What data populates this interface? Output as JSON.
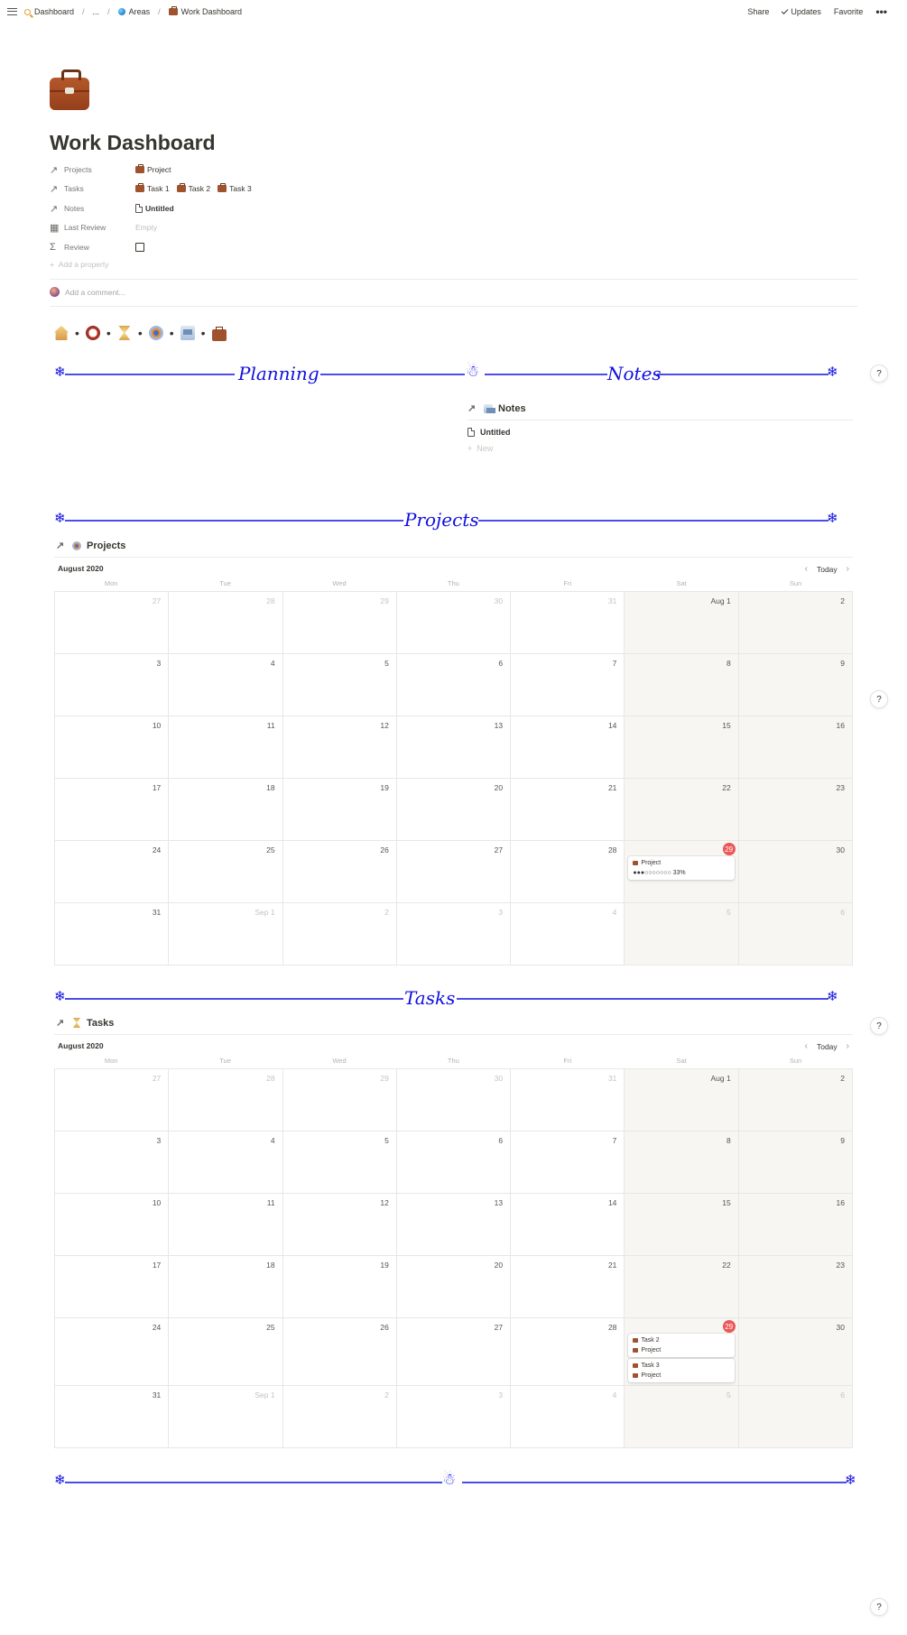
{
  "breadcrumb": {
    "items": [
      {
        "label": "Dashboard",
        "icon": "magnifier-icon"
      },
      {
        "label": "..."
      },
      {
        "label": "Areas",
        "icon": "globe-icon"
      },
      {
        "label": "Work Dashboard",
        "icon": "briefcase-icon"
      }
    ],
    "separator": "/"
  },
  "topbar": {
    "share": "Share",
    "updates": "Updates",
    "favorite": "Favorite",
    "more": "•••"
  },
  "page": {
    "title": "Work Dashboard",
    "icon": "briefcase-icon"
  },
  "properties": {
    "projects": {
      "name": "Projects",
      "values": [
        "Project"
      ]
    },
    "tasks": {
      "name": "Tasks",
      "values": [
        "Task 1",
        "Task 2",
        "Task 3"
      ]
    },
    "notes": {
      "name": "Notes",
      "values": [
        "Untitled"
      ]
    },
    "last_review": {
      "name": "Last Review",
      "value": "Empty"
    },
    "review": {
      "name": "Review",
      "checked": false
    },
    "add_property": "Add a property"
  },
  "comment": {
    "placeholder": "Add a comment..."
  },
  "nav_row": {
    "icons": [
      "house-icon",
      "clock-icon",
      "hourglass-icon",
      "target-icon",
      "newspaper-icon",
      "briefcase-icon"
    ],
    "separator": "•"
  },
  "dividers": {
    "planning": "Planning",
    "notes": "Notes",
    "projects": "Projects",
    "tasks": "Tasks",
    "help": "?"
  },
  "notes_db": {
    "title": "Notes",
    "items": [
      "Untitled"
    ],
    "new_label": "New"
  },
  "projects_db": {
    "title": "Projects",
    "month": "August 2020",
    "today_label": "Today",
    "weekdays": [
      "Mon",
      "Tue",
      "Wed",
      "Thu",
      "Fri",
      "Sat",
      "Sun"
    ],
    "today_date": "29",
    "event": {
      "title": "Project",
      "progress": "●●●○○○○○○○ 33%"
    }
  },
  "tasks_db": {
    "title": "Tasks",
    "month": "August 2020",
    "today_label": "Today",
    "weekdays": [
      "Mon",
      "Tue",
      "Wed",
      "Thu",
      "Fri",
      "Sat",
      "Sun"
    ],
    "today_date": "29",
    "events": [
      {
        "title": "Task 2",
        "project": "Project"
      },
      {
        "title": "Task 3",
        "project": "Project"
      }
    ]
  },
  "calendar_weeks": [
    [
      "27",
      "28",
      "29",
      "30",
      "31",
      "Aug 1",
      "2"
    ],
    [
      "3",
      "4",
      "5",
      "6",
      "7",
      "8",
      "9"
    ],
    [
      "10",
      "11",
      "12",
      "13",
      "14",
      "15",
      "16"
    ],
    [
      "17",
      "18",
      "19",
      "20",
      "21",
      "22",
      "23"
    ],
    [
      "24",
      "25",
      "26",
      "27",
      "28",
      "29",
      "30"
    ],
    [
      "31",
      "Sep 1",
      "2",
      "3",
      "4",
      "5",
      "6"
    ]
  ],
  "colors": {
    "divider_blue": "#1010e0",
    "today_red": "#eb5757",
    "weekend_bg": "#f7f6f3"
  }
}
